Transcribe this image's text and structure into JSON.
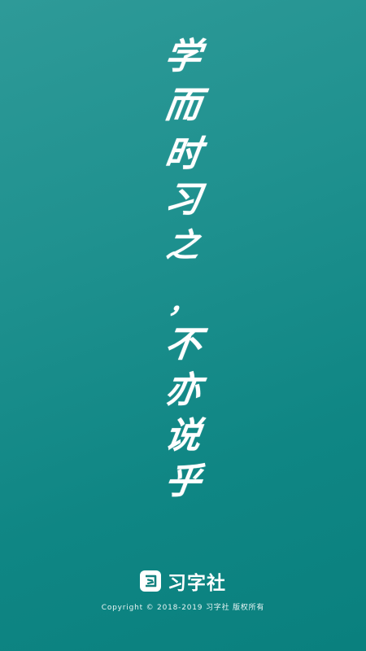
{
  "calligraphy": {
    "glyphs": [
      "学",
      "而",
      "时",
      "习",
      "之",
      "，",
      "不",
      "亦",
      "说",
      "乎"
    ]
  },
  "brand": {
    "icon": "brand-logo-icon",
    "name": "习字社"
  },
  "footer": {
    "copyright": "Copyright © 2018-2019 习字社 版权所有"
  },
  "colors": {
    "background_top": "#2e9a98",
    "background_bottom": "#0a807e",
    "text": "#ffffff"
  }
}
